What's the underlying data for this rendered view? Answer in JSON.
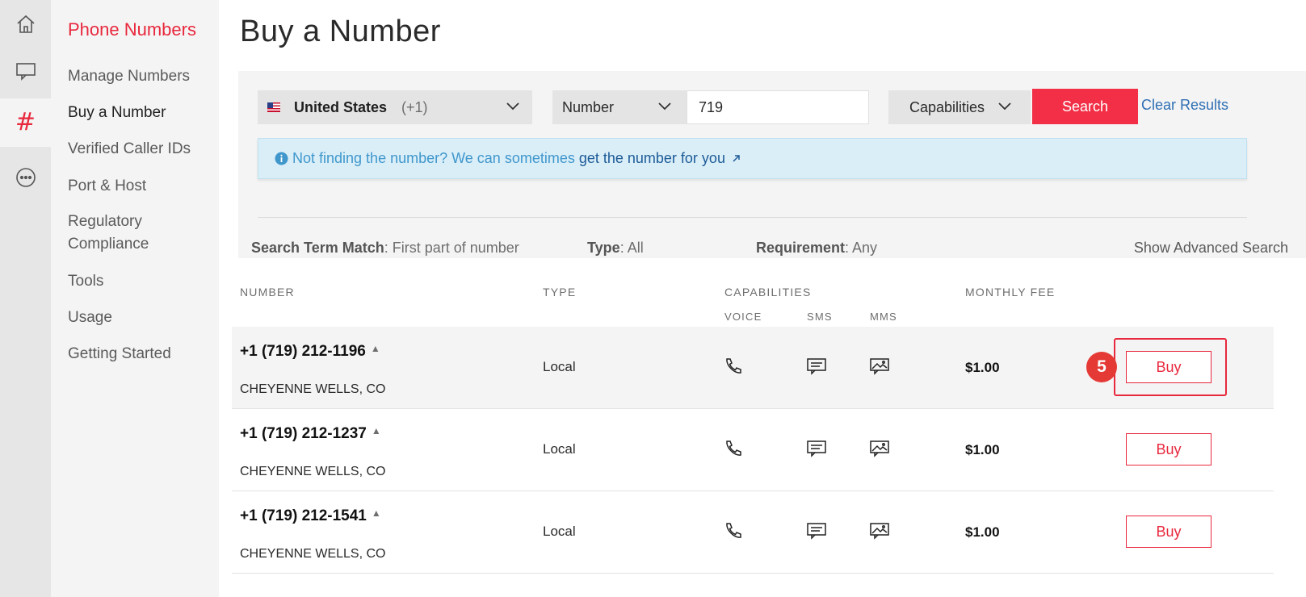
{
  "nav": {
    "section_title": "Phone Numbers",
    "items": [
      {
        "label": "Manage Numbers"
      },
      {
        "label": "Buy a Number"
      },
      {
        "label": "Verified Caller IDs"
      },
      {
        "label": "Port & Host"
      },
      {
        "label": "Regulatory Compliance"
      },
      {
        "label": "Tools"
      },
      {
        "label": "Usage"
      },
      {
        "label": "Getting Started"
      }
    ],
    "active_item": "Buy a Number",
    "rail_icons": [
      "home-icon",
      "chat-icon",
      "hash-icon",
      "more-icon"
    ],
    "hash_glyph": "#"
  },
  "page": {
    "title": "Buy a Number"
  },
  "search": {
    "country": "United States",
    "country_code": "(+1)",
    "match_type": "Number",
    "query": "719",
    "capabilities_label": "Capabilities",
    "search_label": "Search",
    "clear_label": "Clear Results",
    "banner_text": "Not finding the number? We can sometimes",
    "banner_link": "get the number for you"
  },
  "criteria": {
    "term_label": "Search Term Match",
    "term_value": ": First part of number",
    "type_label": "Type",
    "type_value": ": All",
    "req_label": "Requirement",
    "req_value": ": Any",
    "advanced_label": "Show Advanced Search"
  },
  "table": {
    "headers": {
      "number": "NUMBER",
      "type": "TYPE",
      "capabilities": "CAPABILITIES",
      "voice": "VOICE",
      "sms": "SMS",
      "mms": "MMS",
      "fee": "MONTHLY FEE"
    },
    "rows": [
      {
        "number": "+1 (719) 212-1196",
        "location": "CHEYENNE WELLS, CO",
        "type": "Local",
        "fee": "$1.00",
        "buy": "Buy"
      },
      {
        "number": "+1 (719) 212-1237",
        "location": "CHEYENNE WELLS, CO",
        "type": "Local",
        "fee": "$1.00",
        "buy": "Buy"
      },
      {
        "number": "+1 (719) 212-1541",
        "location": "CHEYENNE WELLS, CO",
        "type": "Local",
        "fee": "$1.00",
        "buy": "Buy"
      }
    ]
  },
  "annotation": {
    "step": "5"
  },
  "colors": {
    "accent": "#e8283d",
    "search_button": "#f22f46",
    "link": "#2f6fb4",
    "banner_bg": "#daeef8"
  }
}
